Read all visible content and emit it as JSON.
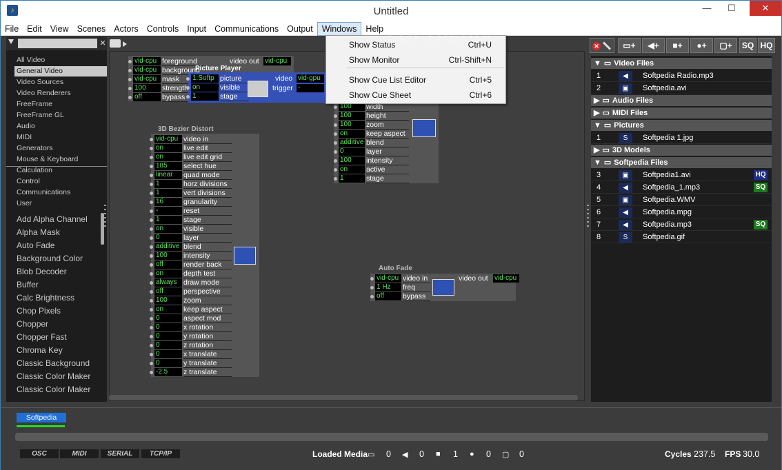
{
  "window": {
    "title": "Untitled",
    "minimize": "—",
    "maximize": "☐",
    "close": "✕"
  },
  "menu": [
    "File",
    "Edit",
    "View",
    "Scenes",
    "Actors",
    "Controls",
    "Input",
    "Communications",
    "Output",
    "Windows",
    "Help"
  ],
  "windows_menu": [
    {
      "label": "Show Status",
      "shortcut": "Ctrl+U"
    },
    {
      "label": "Show Monitor",
      "shortcut": "Ctrl-Shift+N"
    },
    {
      "label": "Show Cue List Editor",
      "shortcut": "Ctrl+5"
    },
    {
      "label": "Show Cue Sheet",
      "shortcut": "Ctrl+6"
    }
  ],
  "watermark": "SOFTPEDIA",
  "left": {
    "filter_placeholder": "",
    "clear": "✕",
    "categories": [
      "All Video",
      "General Video",
      "Video Sources",
      "Video Renderers",
      "FreeFrame",
      "FreeFrame GL",
      "Audio",
      "MIDI",
      "Generators",
      "Mouse & Keyboard",
      "Calculation",
      "Control",
      "Communications",
      "User"
    ],
    "selected_category": 1,
    "actors": [
      "Add Alpha Channel",
      "Alpha Mask",
      "Auto Fade",
      "Background Color",
      "Blob Decoder",
      "Buffer",
      "Calc Brightness",
      "Chop Pixels",
      "Chopper",
      "Chopper Fast",
      "Chroma Key",
      "Classic Background",
      "Classic Color Maker",
      "Classic Color Maker"
    ]
  },
  "nodes": {
    "alpha": {
      "rows": [
        {
          "v": "vid-cpu",
          "l": "foreground"
        },
        {
          "v": "vid-cpu",
          "l": "background"
        },
        {
          "v": "vid-cpu",
          "l": "mask"
        },
        {
          "v": "100",
          "l": "strength"
        },
        {
          "v": "off",
          "l": "bypass"
        }
      ],
      "out_label": "video out",
      "out_val": "vid-cpu"
    },
    "picture": {
      "title": "Picture Player",
      "rows": [
        {
          "v": "1:Softp",
          "l": "picture"
        },
        {
          "v": "on",
          "l": "visible"
        },
        {
          "v": "1",
          "l": "stage"
        }
      ],
      "out_label": "video",
      "out_val": "vid-gpu",
      "trig_label": "trigger",
      "trig_val": "-"
    },
    "renderer": {
      "rows": [
        {
          "v": "100",
          "l": "width"
        },
        {
          "v": "100",
          "l": "height"
        },
        {
          "v": "100",
          "l": "zoom"
        },
        {
          "v": "on",
          "l": "keep aspect"
        },
        {
          "v": "additive",
          "l": "blend"
        },
        {
          "v": "0",
          "l": "layer"
        },
        {
          "v": "100",
          "l": "intensity"
        },
        {
          "v": "on",
          "l": "active"
        },
        {
          "v": "1",
          "l": "stage"
        }
      ]
    },
    "bezier": {
      "title": "3D Bezier Distort",
      "rows": [
        {
          "v": "vid-cpu",
          "l": "video in"
        },
        {
          "v": "on",
          "l": "live edit"
        },
        {
          "v": "on",
          "l": "live edit grid"
        },
        {
          "v": "185",
          "l": "select hue"
        },
        {
          "v": "linear",
          "l": "quad mode"
        },
        {
          "v": "1",
          "l": "horz divisions"
        },
        {
          "v": "1",
          "l": "vert divisions"
        },
        {
          "v": "16",
          "l": "granularity"
        },
        {
          "v": "-",
          "l": "reset"
        },
        {
          "v": "1",
          "l": "stage"
        },
        {
          "v": "on",
          "l": "visible"
        },
        {
          "v": "0",
          "l": "layer"
        },
        {
          "v": "additive",
          "l": "blend"
        },
        {
          "v": "100",
          "l": "intensity"
        },
        {
          "v": "off",
          "l": "render back"
        },
        {
          "v": "on",
          "l": "depth test"
        },
        {
          "v": "always",
          "l": "draw mode"
        },
        {
          "v": "off",
          "l": "perspective"
        },
        {
          "v": "100",
          "l": "zoom"
        },
        {
          "v": "on",
          "l": "keep aspect"
        },
        {
          "v": "0",
          "l": "aspect mod"
        },
        {
          "v": "0",
          "l": "x rotation"
        },
        {
          "v": "0",
          "l": "y rotation"
        },
        {
          "v": "0",
          "l": "z rotation"
        },
        {
          "v": "0",
          "l": "x translate"
        },
        {
          "v": "0",
          "l": "y translate"
        },
        {
          "v": "-2.5",
          "l": "z translate"
        }
      ]
    },
    "autofade": {
      "title": "Auto Fade",
      "rows": [
        {
          "v": "vid-cpu",
          "l": "video in"
        },
        {
          "v": "1 Hz",
          "l": "freq"
        },
        {
          "v": "off",
          "l": "bypass"
        }
      ],
      "out_label": "video out",
      "out_val": "vid-cpu"
    }
  },
  "media": {
    "toolbar": [
      "SQ",
      "HQ"
    ],
    "sections": [
      {
        "name": "Video Files",
        "expanded": true,
        "items": [
          {
            "n": "1",
            "name": "Softpedia Radio.mp3",
            "icon": "speaker"
          },
          {
            "n": "2",
            "name": "Softpedia.avi",
            "icon": "video"
          }
        ]
      },
      {
        "name": "Audio Files",
        "expanded": false,
        "items": []
      },
      {
        "name": "MIDI Files",
        "expanded": false,
        "items": []
      },
      {
        "name": "Pictures",
        "expanded": true,
        "items": [
          {
            "n": "1",
            "name": "Softpedia 1.jpg",
            "icon": "s"
          }
        ]
      },
      {
        "name": "3D Models",
        "expanded": false,
        "items": []
      },
      {
        "name": "Softpedia Files",
        "expanded": true,
        "items": [
          {
            "n": "3",
            "name": "Softpedia1.avi",
            "icon": "video",
            "badge": "HQ"
          },
          {
            "n": "4",
            "name": "Softpedia_1.mp3",
            "icon": "speaker",
            "badge": "SQ"
          },
          {
            "n": "5",
            "name": "Softpedia.WMV",
            "icon": "video"
          },
          {
            "n": "6",
            "name": "Softpedia.mpg",
            "icon": "speaker"
          },
          {
            "n": "7",
            "name": "Softpedia.mp3",
            "icon": "speaker",
            "badge": "SQ"
          },
          {
            "n": "8",
            "name": "Softpedia.gif",
            "icon": "s"
          }
        ]
      }
    ]
  },
  "cue": {
    "tab": "Softpedia"
  },
  "status": {
    "buttons": [
      "OSC",
      "MIDI",
      "SERIAL",
      "TCP/IP"
    ],
    "loaded_media_label": "Loaded Media",
    "counts": [
      "0",
      "0",
      "1",
      "0",
      "0"
    ],
    "cycles_label": "Cycles",
    "cycles": "237.5",
    "fps_label": "FPS",
    "fps": "30.0"
  },
  "colors": {
    "accent": "#1f6fd8",
    "value_text": "#5fe25f",
    "close": "#c7302b",
    "sq_badge": "#1d7a1d",
    "hq_badge": "#1d2f8a"
  }
}
